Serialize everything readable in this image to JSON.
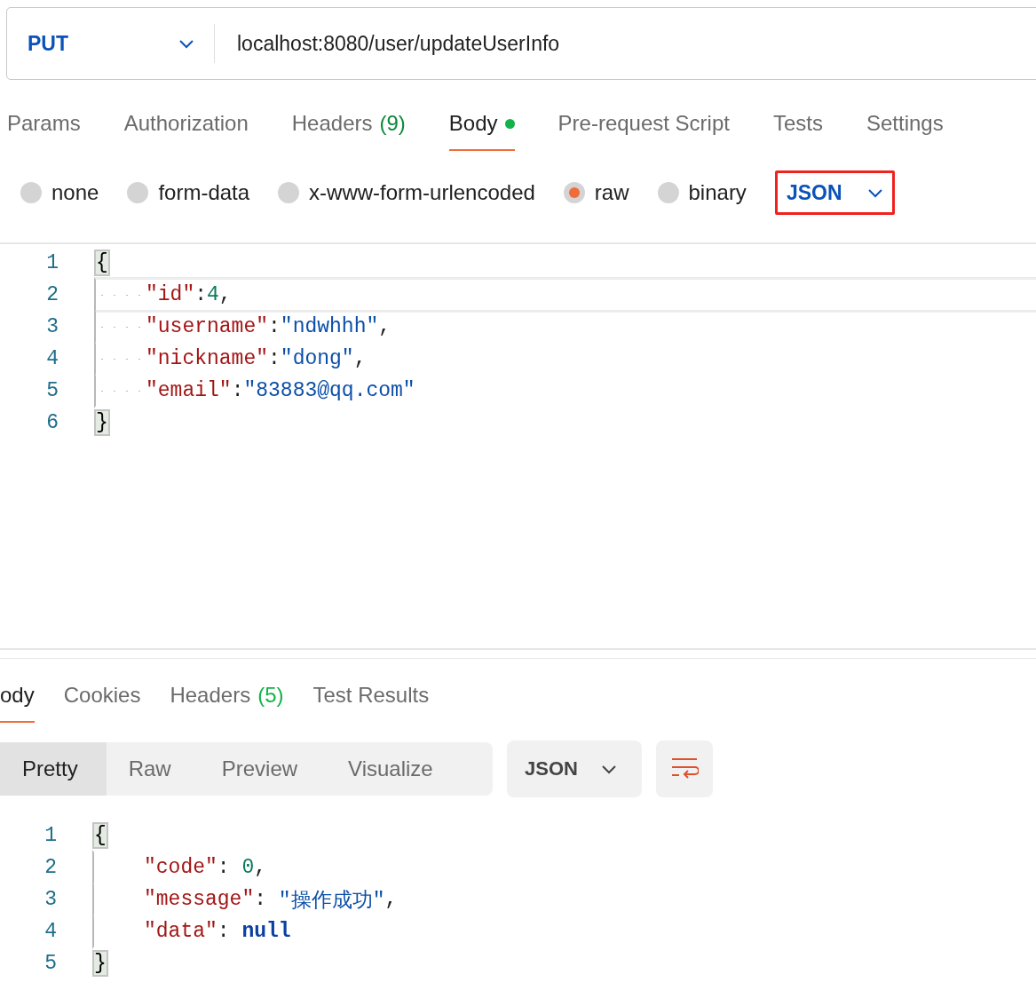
{
  "request": {
    "method": "PUT",
    "url": "localhost:8080/user/updateUserInfo"
  },
  "request_tabs": [
    {
      "label": "Params",
      "selected": false,
      "dot": false
    },
    {
      "label": "Authorization",
      "selected": false,
      "dot": false
    },
    {
      "label": "Headers",
      "count": "(9)",
      "selected": false,
      "dot": false
    },
    {
      "label": "Body",
      "selected": true,
      "dot": true
    },
    {
      "label": "Pre-request Script",
      "selected": false,
      "dot": false
    },
    {
      "label": "Tests",
      "selected": false,
      "dot": false
    },
    {
      "label": "Settings",
      "selected": false,
      "dot": false
    }
  ],
  "body_types": [
    {
      "label": "none",
      "selected": false
    },
    {
      "label": "form-data",
      "selected": false
    },
    {
      "label": "x-www-form-urlencoded",
      "selected": false
    },
    {
      "label": "raw",
      "selected": true
    },
    {
      "label": "binary",
      "selected": false
    }
  ],
  "body_format": {
    "label": "JSON",
    "highlighted": true
  },
  "request_editor": {
    "whitespace_dots": true,
    "lines": [
      {
        "number": "1",
        "indented": false,
        "active": false,
        "tokens": [
          {
            "kind": "brace",
            "text": "{"
          }
        ]
      },
      {
        "number": "2",
        "indented": true,
        "active": true,
        "tokens": [
          {
            "kind": "key",
            "text": "\"id\""
          },
          {
            "kind": "punct",
            "text": ":"
          },
          {
            "kind": "number",
            "text": "4"
          },
          {
            "kind": "punct",
            "text": ","
          }
        ]
      },
      {
        "number": "3",
        "indented": true,
        "active": false,
        "tokens": [
          {
            "kind": "key",
            "text": "\"username\""
          },
          {
            "kind": "punct",
            "text": ":"
          },
          {
            "kind": "string",
            "text": "\"ndwhhh\""
          },
          {
            "kind": "punct",
            "text": ","
          }
        ]
      },
      {
        "number": "4",
        "indented": true,
        "active": false,
        "tokens": [
          {
            "kind": "key",
            "text": "\"nickname\""
          },
          {
            "kind": "punct",
            "text": ":"
          },
          {
            "kind": "string",
            "text": "\"dong\""
          },
          {
            "kind": "punct",
            "text": ","
          }
        ]
      },
      {
        "number": "5",
        "indented": true,
        "active": false,
        "tokens": [
          {
            "kind": "key",
            "text": "\"email\""
          },
          {
            "kind": "punct",
            "text": ":"
          },
          {
            "kind": "string",
            "text": "\"83883@qq.com\""
          }
        ]
      },
      {
        "number": "6",
        "indented": false,
        "active": false,
        "tokens": [
          {
            "kind": "brace",
            "text": "}"
          }
        ]
      }
    ]
  },
  "response_tabs": [
    {
      "label": "ody",
      "selected": true
    },
    {
      "label": "Cookies",
      "selected": false
    },
    {
      "label": "Headers",
      "count": "(5)",
      "selected": false
    },
    {
      "label": "Test Results",
      "selected": false
    }
  ],
  "view_modes": [
    {
      "label": "Pretty",
      "selected": true
    },
    {
      "label": "Raw",
      "selected": false
    },
    {
      "label": "Preview",
      "selected": false
    },
    {
      "label": "Visualize",
      "selected": false
    }
  ],
  "response_format": {
    "label": "JSON",
    "highlighted": false
  },
  "response_editor": {
    "lines": [
      {
        "number": "1",
        "indented": false,
        "tokens": [
          {
            "kind": "brace",
            "text": "{"
          }
        ]
      },
      {
        "number": "2",
        "indented": true,
        "tokens": [
          {
            "kind": "key",
            "text": "\"code\""
          },
          {
            "kind": "punct",
            "text": ": "
          },
          {
            "kind": "number",
            "text": "0"
          },
          {
            "kind": "punct",
            "text": ","
          }
        ]
      },
      {
        "number": "3",
        "indented": true,
        "tokens": [
          {
            "kind": "key",
            "text": "\"message\""
          },
          {
            "kind": "punct",
            "text": ": "
          },
          {
            "kind": "string",
            "text": "\"操作成功\""
          },
          {
            "kind": "punct",
            "text": ","
          }
        ]
      },
      {
        "number": "4",
        "indented": true,
        "tokens": [
          {
            "kind": "key",
            "text": "\"data\""
          },
          {
            "kind": "punct",
            "text": ": "
          },
          {
            "kind": "null",
            "text": "null"
          }
        ]
      },
      {
        "number": "5",
        "indented": false,
        "tokens": [
          {
            "kind": "brace",
            "text": "}"
          }
        ]
      }
    ]
  }
}
